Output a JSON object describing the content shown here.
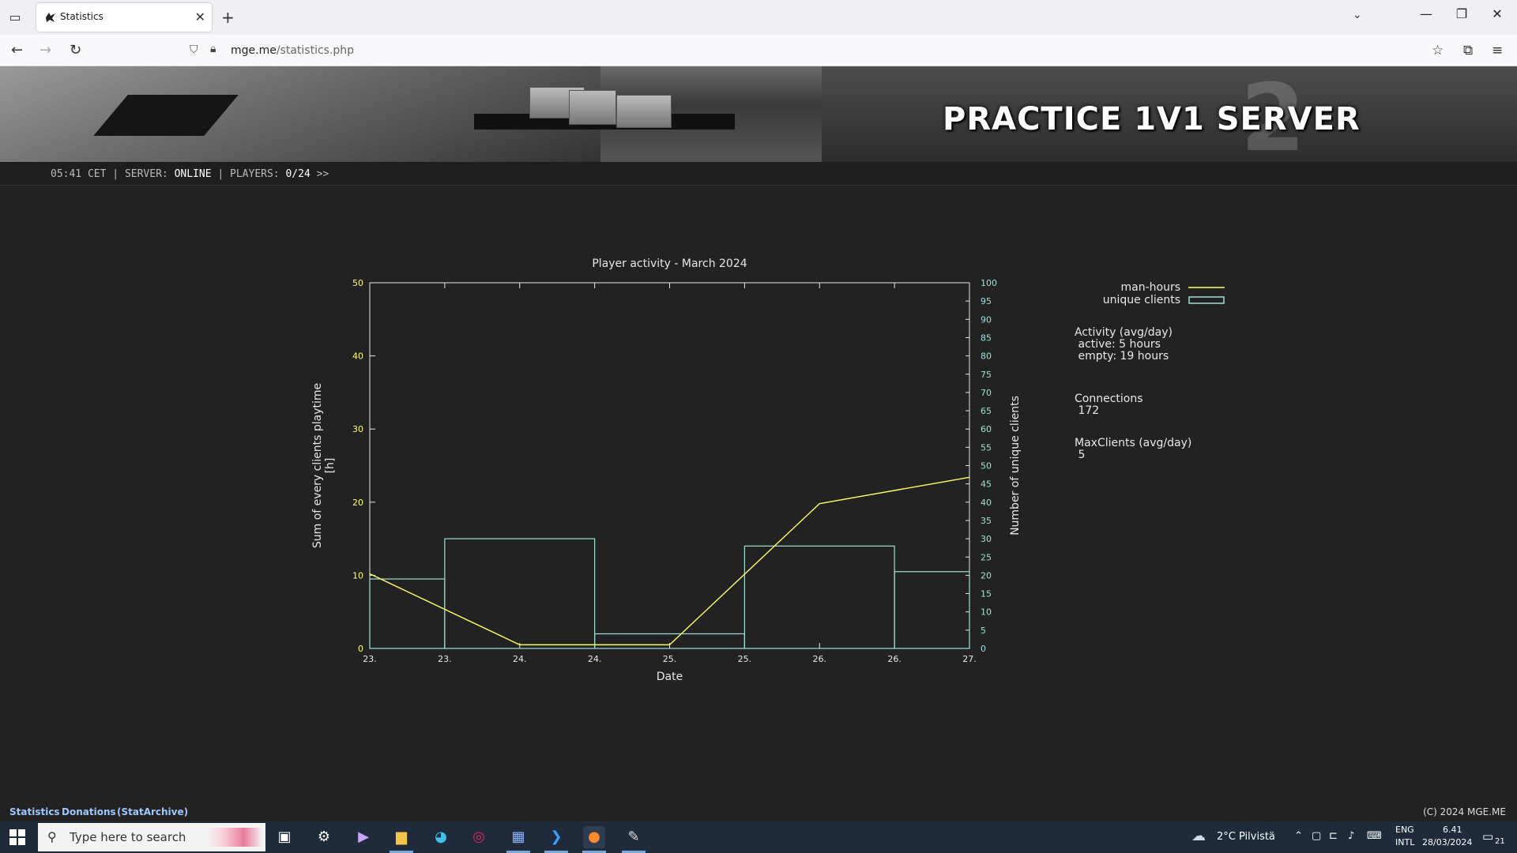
{
  "browser": {
    "tab_title": "Statistics",
    "new_tab": "+",
    "tab_close": "✕",
    "url_host": "mge.me",
    "url_path": "/statistics.php"
  },
  "banner": {
    "title": "PRACTICE 1V1 SERVER",
    "watermark": "2"
  },
  "status": {
    "time": "05:41 CET",
    "server_label": "SERVER:",
    "server_state": "ONLINE",
    "players_label": "PLAYERS:",
    "players_value": "0/24",
    "more": ">>"
  },
  "chart_data": {
    "type": "line",
    "title": "Player activity - March 2024",
    "xlabel": "Date",
    "ylabel": "Sum of every clients playtime",
    "ylabel_unit": "[h]",
    "y2label": "Number of unique clients",
    "x_ticks": [
      "23.",
      "23.",
      "24.",
      "24.",
      "25.",
      "25.",
      "26.",
      "26.",
      "27."
    ],
    "ylim": [
      0,
      50
    ],
    "y_ticks": [
      0,
      10,
      20,
      30,
      40,
      50
    ],
    "y2lim": [
      0,
      100
    ],
    "y2_ticks": [
      0,
      5,
      10,
      15,
      20,
      25,
      30,
      35,
      40,
      45,
      50,
      55,
      60,
      65,
      70,
      75,
      80,
      85,
      90,
      95,
      100
    ],
    "series": [
      {
        "name": "man-hours",
        "color": "#ffff66",
        "axis": "y",
        "points": [
          [
            0,
            10.2
          ],
          [
            2,
            0.5
          ],
          [
            4,
            0.5
          ],
          [
            6,
            19.8
          ],
          [
            8,
            23.4
          ]
        ]
      },
      {
        "name": "unique clients",
        "color": "#9fe0d6",
        "axis": "y2",
        "style": "steps",
        "steps": [
          [
            0,
            1,
            19
          ],
          [
            1,
            3,
            30
          ],
          [
            3,
            5,
            4
          ],
          [
            5,
            7,
            28
          ],
          [
            7,
            8,
            21
          ]
        ]
      }
    ]
  },
  "stats": {
    "activity_header": "Activity (avg/day)",
    "active": " active: 5 hours",
    "empty": " empty: 19 hours",
    "connections_header": "Connections",
    "connections": " 172",
    "maxclients_header": "MaxClients (avg/day)",
    "maxclients": " 5"
  },
  "footer": {
    "link1": "Statistics",
    "link2": "Donations",
    "link3": "(StatArchive)",
    "copyright": "(C) 2024 MGE.ME"
  },
  "taskbar": {
    "search_placeholder": "Type here to search",
    "weather": "2°C  Pilvistä",
    "lang1": "ENG",
    "lang2": "INTL",
    "time": "6.41",
    "date": "28/03/2024",
    "notifications": "21"
  }
}
